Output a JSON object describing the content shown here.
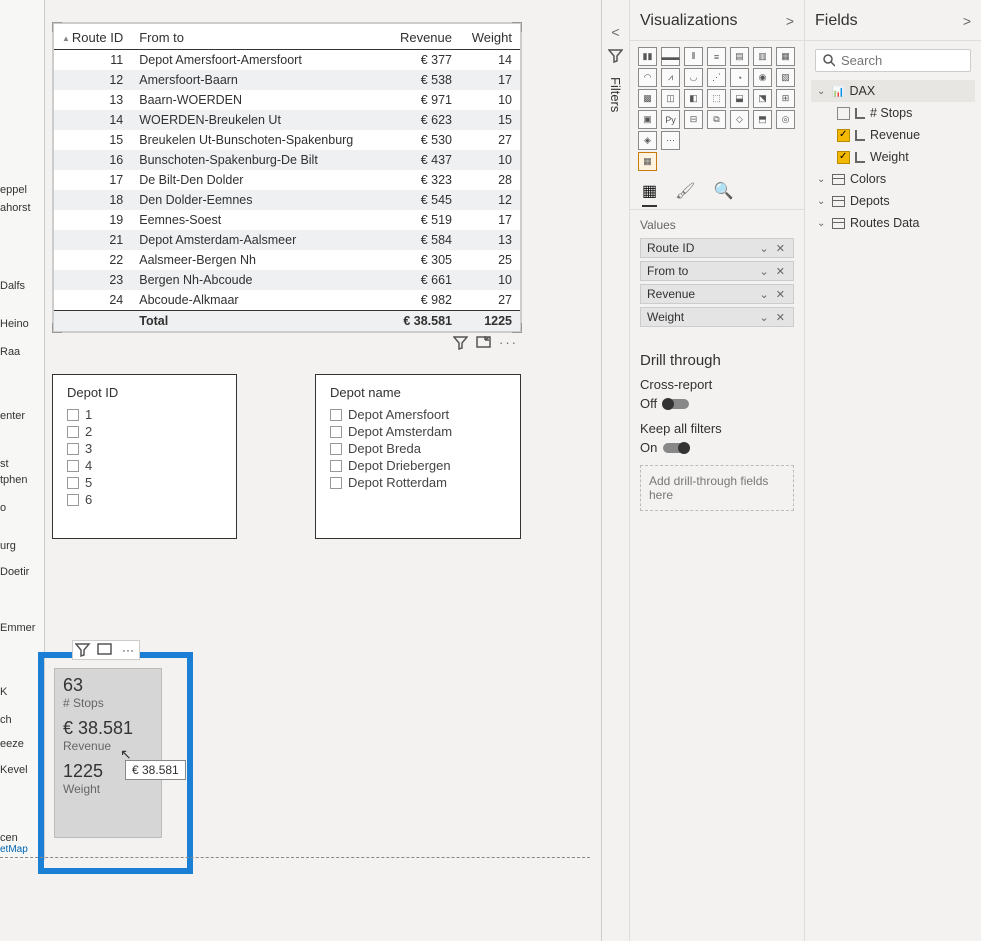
{
  "map_places": [
    "eppel",
    "ahorst",
    "Dalfs",
    "Heino",
    "Raa",
    "enter",
    "st",
    "tphen",
    "o",
    "urg",
    "Doetir",
    "Emmer",
    "K",
    "ch",
    "eeze",
    "Kevel",
    "cen",
    "etMap"
  ],
  "table": {
    "headers": [
      "Route ID",
      "From to",
      "Revenue",
      "Weight"
    ],
    "rows": [
      {
        "id": "11",
        "ft": "Depot Amersfoort-Amersfoort",
        "rev": "€ 377",
        "wt": "14"
      },
      {
        "id": "12",
        "ft": "Amersfoort-Baarn",
        "rev": "€ 538",
        "wt": "17"
      },
      {
        "id": "13",
        "ft": "Baarn-WOERDEN",
        "rev": "€ 971",
        "wt": "10"
      },
      {
        "id": "14",
        "ft": "WOERDEN-Breukelen Ut",
        "rev": "€ 623",
        "wt": "15"
      },
      {
        "id": "15",
        "ft": "Breukelen Ut-Bunschoten-Spakenburg",
        "rev": "€ 530",
        "wt": "27"
      },
      {
        "id": "16",
        "ft": "Bunschoten-Spakenburg-De Bilt",
        "rev": "€ 437",
        "wt": "10"
      },
      {
        "id": "17",
        "ft": "De Bilt-Den Dolder",
        "rev": "€ 323",
        "wt": "28"
      },
      {
        "id": "18",
        "ft": "Den Dolder-Eemnes",
        "rev": "€ 545",
        "wt": "12"
      },
      {
        "id": "19",
        "ft": "Eemnes-Soest",
        "rev": "€ 519",
        "wt": "17"
      },
      {
        "id": "21",
        "ft": "Depot Amsterdam-Aalsmeer",
        "rev": "€ 584",
        "wt": "13"
      },
      {
        "id": "22",
        "ft": "Aalsmeer-Bergen Nh",
        "rev": "€ 305",
        "wt": "25"
      },
      {
        "id": "23",
        "ft": "Bergen Nh-Abcoude",
        "rev": "€ 661",
        "wt": "10"
      },
      {
        "id": "24",
        "ft": "Abcoude-Alkmaar",
        "rev": "€ 982",
        "wt": "27"
      }
    ],
    "total": {
      "label": "Total",
      "rev": "€ 38.581",
      "wt": "1225"
    }
  },
  "slicer_depot_id": {
    "title": "Depot ID",
    "items": [
      "1",
      "2",
      "3",
      "4",
      "5",
      "6"
    ]
  },
  "slicer_depot_name": {
    "title": "Depot name",
    "items": [
      "Depot Amersfoort",
      "Depot Amsterdam",
      "Depot Breda",
      "Depot Driebergen",
      "Depot Rotterdam"
    ]
  },
  "card": {
    "stops_val": "63",
    "stops_lab": "# Stops",
    "rev_val": "€ 38.581",
    "rev_lab": "Revenue",
    "wt_val": "1225",
    "wt_lab": "Weight",
    "tooltip": "€ 38.581"
  },
  "panes": {
    "visualizations": "Visualizations",
    "fields": "Fields",
    "filters": "Filters",
    "values": "Values",
    "drill_through": "Drill through",
    "cross_report": "Cross-report",
    "off": "Off",
    "keep_filters": "Keep all filters",
    "on": "On",
    "drill_drop": "Add drill-through fields here",
    "search": "Search"
  },
  "value_fields": [
    "Route ID",
    "From to",
    "Revenue",
    "Weight"
  ],
  "field_tree": {
    "dax": {
      "name": "DAX",
      "expanded": true,
      "items": [
        {
          "name": "# Stops",
          "checked": false
        },
        {
          "name": "Revenue",
          "checked": true
        },
        {
          "name": "Weight",
          "checked": true
        }
      ]
    },
    "others": [
      "Colors",
      "Depots",
      "Routes Data"
    ]
  }
}
